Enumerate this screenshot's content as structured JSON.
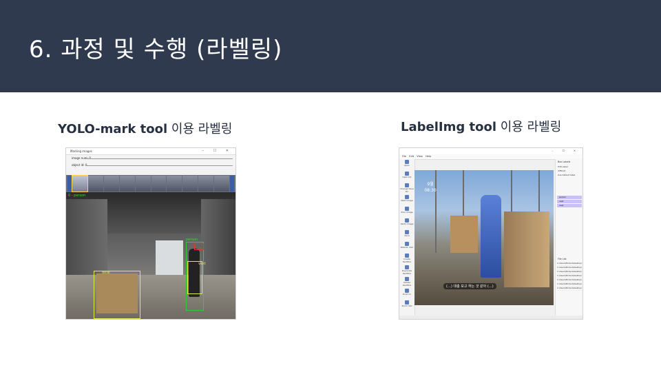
{
  "slide": {
    "title": "6. 과정 및 수행 (라벨링)",
    "left_caption_tool": "YOLO-mark tool",
    "left_caption_suffix": "이용 라벨링",
    "right_caption_tool": "LabelImg tool",
    "right_caption_suffix": "이용 라벨링"
  },
  "colors": {
    "header_bg": "#2f3a4f",
    "title_text": "#ffffff",
    "caption_text": "#263040"
  },
  "yolo_mark": {
    "window_title": "Marking images",
    "image_num_label": "image num: 0",
    "object_id_label": "object id: 0",
    "overlay_text": "0 - person",
    "box_labels": [
      "person",
      "vest",
      "desk"
    ]
  },
  "labelimg": {
    "menu": [
      "File",
      "Edit",
      "View",
      "Help"
    ],
    "tools": [
      "Open",
      "Open Dir",
      "Change Save Dir",
      "Next Image",
      "Prev Image",
      "Verify Image",
      "Save",
      "PASCAL VOC",
      "Create RectBox",
      "Duplicate RectBox",
      "Delete RectBox",
      "Zoom In",
      "Zoom Out"
    ],
    "box_labels_header": "Box Labels",
    "edit_label": "Edit Label",
    "difficult": "difficult",
    "use_default_label": "Use default label",
    "labels": [
      "person",
      "vest",
      "vest"
    ],
    "file_list_header": "File List",
    "files": [
      "C:\\Users\\Mohsin\\Desktop\\Mohsin",
      "C:\\Users\\Mohsin\\Desktop\\Mohsin",
      "C:\\Users\\Mohsin\\Desktop\\Mohsin",
      "C:\\Users\\Mohsin\\Desktop\\Mohsin",
      "C:\\Users\\Mohsin\\Desktop\\Mohsin",
      "C:\\Users\\Mohsin\\Desktop\\Mohsin",
      "C:\\Users\\Mohsin\\Desktop\\Mohsin"
    ],
    "clock_date": "9월",
    "clock_time": "08:30",
    "subtitle": "(…) 대충 보고 하는 것 같아 (…)"
  }
}
